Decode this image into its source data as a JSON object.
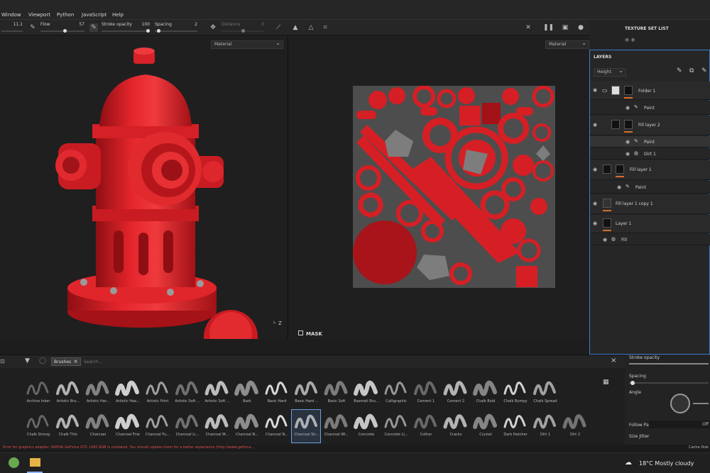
{
  "menu": {
    "items": [
      "Window",
      "Viewport",
      "Python",
      "JavaScript",
      "Help"
    ]
  },
  "toolbar": {
    "size_value": "11.1",
    "flow_label": "Flow",
    "flow_value": "57",
    "flow_level": 0.57,
    "stroke_opacity_label": "Stroke opacity",
    "stroke_opacity_value": "100",
    "stroke_opacity_level": 1.0,
    "spacing_label": "Spacing",
    "spacing_value": "2",
    "spacing_level": 0.05,
    "distance_label": "Distance",
    "distance_value": "3"
  },
  "viewport3d": {
    "material_select": "Material",
    "axis_label": "Z"
  },
  "viewport2d": {
    "material_select": "Material",
    "mask_label": "MASK"
  },
  "texture_set_list": {
    "title": "TEXTURE SET LIST"
  },
  "layers": {
    "title": "LAYERS",
    "blend_select": "Height",
    "rows": [
      {
        "name": "Folder 1",
        "type": "folder"
      },
      {
        "name": "Paint",
        "type": "sub"
      },
      {
        "name": "Fill layer 2",
        "type": "layer"
      },
      {
        "name": "Paint",
        "type": "sub-selected"
      },
      {
        "name": "Dirt 1",
        "type": "sub"
      },
      {
        "name": "Fill layer 1",
        "type": "layer"
      },
      {
        "name": "Paint",
        "type": "sub"
      },
      {
        "name": "Fill layer 1 copy 1",
        "type": "layer"
      },
      {
        "name": "Layer 1",
        "type": "layer"
      },
      {
        "name": "Fill",
        "type": "sub"
      }
    ]
  },
  "shelf": {
    "tab_label": "Brushes",
    "search_placeholder": "Search...",
    "brushes_row1": [
      "Archive Inker",
      "Artistic Bru...",
      "Artistic Har...",
      "Artistic Hea...",
      "Artistic Print",
      "Artistic Soft ...",
      "Artistic Soft ...",
      "Bark",
      "Basic Hard",
      "Basic Hard ...",
      "Basic Soft",
      "Basmati Bru...",
      "Calligraphic",
      "Cement 1",
      "Cement 2",
      "Chalk Bold",
      "Chalk Bumpy",
      "Chalk Spread"
    ],
    "brushes_row2": [
      "Chalk Strong",
      "Chalk Thin",
      "Charcoal",
      "Charcoal Fine",
      "Charcoal Fu...",
      "Charcoal Li...",
      "Charcoal M...",
      "Charcoal N...",
      "Charcoal N...",
      "Charcoal Str...",
      "Charcoal Wi...",
      "Concrete",
      "Concrete Li...",
      "Cotton",
      "Cracks",
      "Crystal",
      "Dark Hatcher",
      "Dirt 1",
      "Dirt 2"
    ]
  },
  "properties": {
    "stroke_opacity_label": "Stroke opacity",
    "spacing_label": "Spacing",
    "angle_label": "Angle",
    "follow_path_label": "Follow Path",
    "follow_path_value": "Off",
    "size_jitter_label": "Size Jitter"
  },
  "status": {
    "message": "Error for graphics adapter: NVIDIA GeForce GTX 1060 6GB is outdated. You should update them for a better experience (http://www.geforce...",
    "cache": "Cache Disk"
  },
  "taskbar": {
    "weather": "18°C  Mostly cloudy"
  },
  "colors": {
    "accent": "#3d7cc9",
    "hydrant": "#d81f26",
    "layer_tag": "#d96b2b",
    "error": "#d9534f"
  }
}
